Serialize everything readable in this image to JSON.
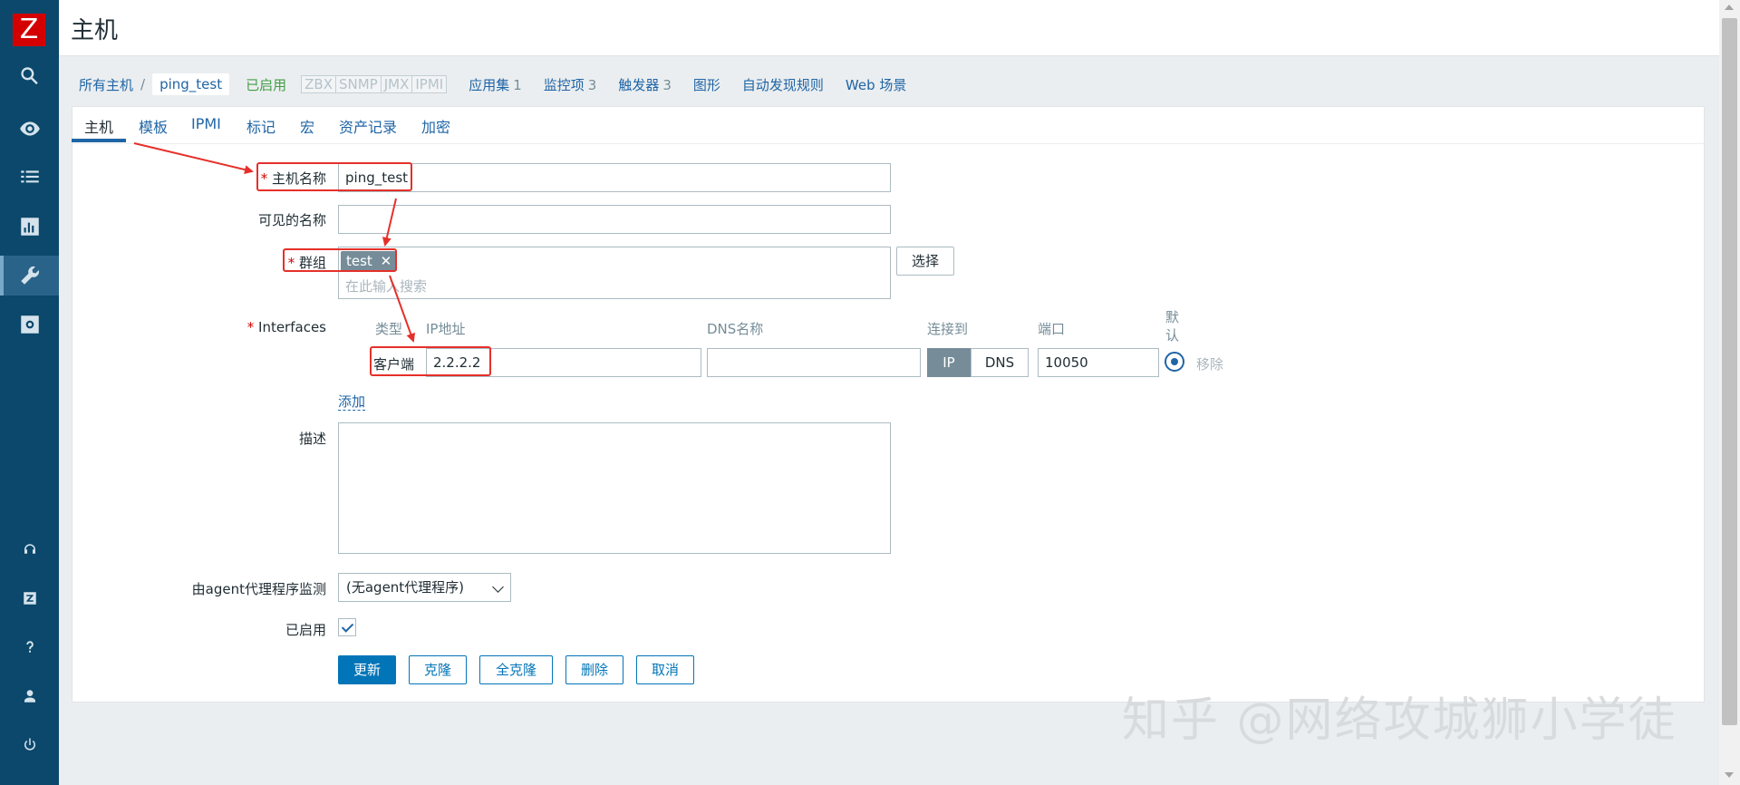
{
  "app": {
    "logo": "Z",
    "page_title": "主机"
  },
  "sidebar": {
    "icons": [
      "search-icon",
      "eye-icon",
      "list-icon",
      "chart-icon",
      "wrench-icon",
      "gear-icon",
      "headset-icon",
      "zabbix-icon",
      "help-icon",
      "user-icon",
      "power-icon"
    ],
    "active": "wrench-icon"
  },
  "breadcrumb": {
    "all_hosts": "所有主机",
    "separator": "/",
    "current": "ping_test",
    "status": "已启用",
    "availability": [
      "ZBX",
      "SNMP",
      "JMX",
      "IPMI"
    ],
    "links": [
      {
        "label": "应用集",
        "count": "1"
      },
      {
        "label": "监控项",
        "count": "3"
      },
      {
        "label": "触发器",
        "count": "3"
      },
      {
        "label": "图形",
        "count": ""
      },
      {
        "label": "自动发现规则",
        "count": ""
      },
      {
        "label": "Web 场景",
        "count": ""
      }
    ]
  },
  "tabs": [
    "主机",
    "模板",
    "IPMI",
    "标记",
    "宏",
    "资产记录",
    "加密"
  ],
  "form": {
    "required_mark": "*",
    "host_name": {
      "label": "主机名称",
      "value": "ping_test"
    },
    "visible_name": {
      "label": "可见的名称",
      "value": ""
    },
    "groups": {
      "label": "群组",
      "tag": "test",
      "tag_remove": "✕",
      "placeholder": "在此输入搜索",
      "select_button": "选择"
    },
    "interfaces": {
      "label": "Interfaces",
      "columns": {
        "type": "类型",
        "ip": "IP地址",
        "dns": "DNS名称",
        "connect": "连接到",
        "port": "端口",
        "default": "默认"
      },
      "row": {
        "type": "客户端",
        "ip": "2.2.2.2",
        "dns": "",
        "connect_ip": "IP",
        "connect_dns": "DNS",
        "port": "10050",
        "remove": "移除"
      },
      "add": "添加"
    },
    "description": {
      "label": "描述",
      "value": ""
    },
    "proxy": {
      "label": "由agent代理程序监测",
      "value": "(无agent代理程序)"
    },
    "enabled": {
      "label": "已启用",
      "checked": true
    },
    "buttons": {
      "update": "更新",
      "clone": "克隆",
      "full_clone": "全克隆",
      "delete": "删除",
      "cancel": "取消"
    }
  },
  "watermark": "知乎 @网络攻城狮小学徒",
  "colors": {
    "sidebar": "#0b486b",
    "link": "#1f65a6",
    "primary": "#0275b8",
    "enabled": "#429e47",
    "annotation": "#e5302a"
  }
}
